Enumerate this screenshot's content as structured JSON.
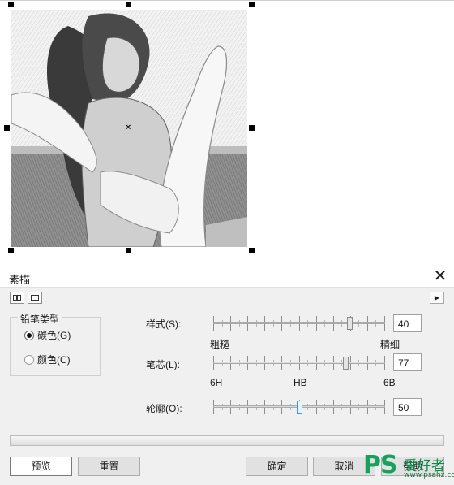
{
  "dialog": {
    "title": "素描",
    "close_glyph": "✕",
    "expand_glyph": "▶",
    "pencil_type": {
      "legend": "铅笔类型",
      "options": [
        {
          "label": "碳色(G)",
          "selected": true
        },
        {
          "label": "颜色(C)",
          "selected": false
        }
      ]
    },
    "sliders": {
      "style": {
        "label": "样式(S):",
        "value": "40",
        "min_label": "粗糙",
        "max_label": "精细"
      },
      "core": {
        "label": "笔芯(L):",
        "value": "77",
        "min_label": "6H",
        "mid_label": "HB",
        "max_label": "6B"
      },
      "outline": {
        "label": "轮廓(O):",
        "value": "50"
      }
    },
    "buttons": {
      "preview": "预览",
      "reset": "重置",
      "ok": "确定",
      "cancel": "取消",
      "help": "帮助"
    }
  },
  "watermark": {
    "ps": "PS",
    "cn": "爱好者",
    "url": "www.psahz.com"
  },
  "colors": {
    "accent": "#3c9bd6",
    "watermark_green": "#17a15c"
  },
  "icons": {
    "view_split": "split-preview-icon",
    "view_single": "single-preview-icon",
    "expand": "play-triangle-icon",
    "close": "close-icon"
  }
}
